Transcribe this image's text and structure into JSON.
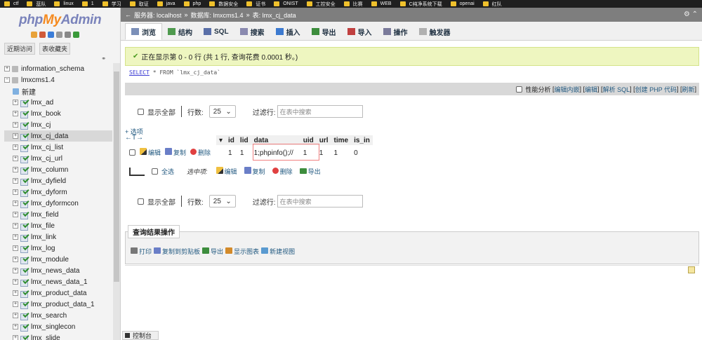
{
  "bookmarks": [
    "ctf",
    "蓝队",
    "linux",
    "1",
    "学习",
    "取证",
    "java",
    "php",
    "数据安全",
    "证书",
    "ONIST",
    "工控安全",
    "比赛",
    "WEB",
    "C纯净系统下载",
    "openai",
    "红队"
  ],
  "logo": {
    "php": "php",
    "my": "My",
    "admin": "Admin"
  },
  "sidebar": {
    "tab_recent": "近期访问",
    "tab_fav": "表收藏夹",
    "databases": [
      {
        "name": "information_schema"
      },
      {
        "name": "lmxcms1.4"
      }
    ],
    "new_label": "新建",
    "tables": [
      "lmx_ad",
      "lmx_book",
      "lmx_cj",
      "lmx_cj_data",
      "lmx_cj_list",
      "lmx_cj_url",
      "lmx_column",
      "lmx_dyfield",
      "lmx_dyform",
      "lmx_dyformcon",
      "lmx_field",
      "lmx_file",
      "lmx_link",
      "lmx_log",
      "lmx_module",
      "lmx_news_data",
      "lmx_news_data_1",
      "lmx_product_data",
      "lmx_product_data_1",
      "lmx_search",
      "lmx_singlecon",
      "lmx_slide"
    ],
    "selected_table": "lmx_cj_data"
  },
  "breadcrumb": {
    "server": "服务器: localhost",
    "database": "数据库: lmxcms1.4",
    "table": "表: lmx_cj_data"
  },
  "tabs": [
    {
      "label": "浏览",
      "active": true
    },
    {
      "label": "结构"
    },
    {
      "label": "SQL"
    },
    {
      "label": "搜索"
    },
    {
      "label": "插入"
    },
    {
      "label": "导出"
    },
    {
      "label": "导入"
    },
    {
      "label": "操作"
    },
    {
      "label": "触发器"
    }
  ],
  "message": "正在显示第 0 - 0 行 (共 1 行, 查询花费 0.0001 秒。)",
  "sql": {
    "select": "SELECT",
    "rest": "* FROM `lmx_cj_data`"
  },
  "perf": {
    "profiling": "性能分析",
    "inline_edit": "编辑内嵌",
    "edit": "编辑",
    "explain": "解析 SQL",
    "create_php": "创建 PHP 代码",
    "refresh": "刷新"
  },
  "controls": {
    "show_all": "显示全部",
    "rows_label": "行数:",
    "rows_value": "25",
    "filter_label": "过滤行:",
    "filter_placeholder": "在表中搜索"
  },
  "options_link": "+ 选项",
  "columns": [
    "id",
    "lid",
    "data",
    "uid",
    "url",
    "time",
    "is_in"
  ],
  "row": {
    "actions": {
      "edit": "编辑",
      "copy": "复制",
      "delete": "删除"
    },
    "values": [
      "1",
      "1",
      "1;phpinfo();//",
      "1",
      "1",
      "1",
      "0"
    ]
  },
  "bulk": {
    "select_all": "全选",
    "selected_label": "选中项:",
    "edit": "编辑",
    "copy": "复制",
    "delete": "删除",
    "export": "导出"
  },
  "query_ops": {
    "title": "查询结果操作",
    "print": "打印",
    "copy_clipboard": "复制到剪贴板",
    "export": "导出",
    "show_chart": "显示图表",
    "new_view": "新建视图"
  },
  "console": "控制台"
}
